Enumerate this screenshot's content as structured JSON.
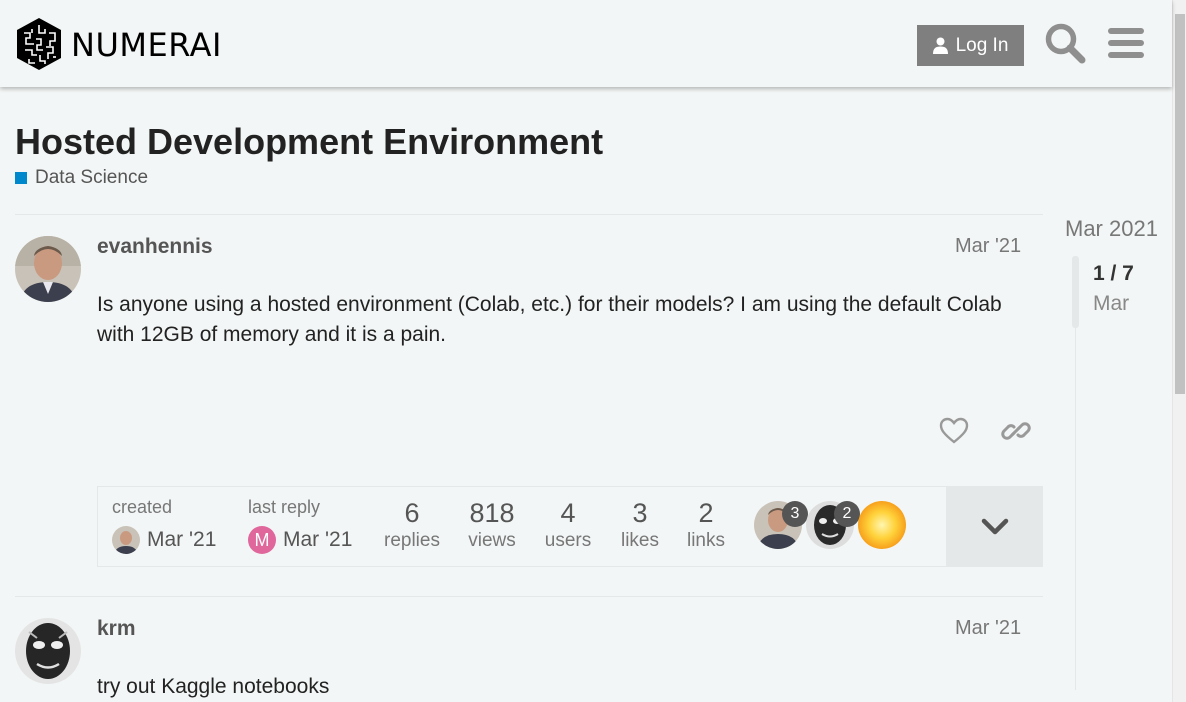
{
  "header": {
    "logo_text": "NUMERAI",
    "login_label": "Log In"
  },
  "topic": {
    "title": "Hosted Development Environment",
    "category": "Data Science",
    "category_color": "#0088cc"
  },
  "posts": [
    {
      "username": "evanhennis",
      "date": "Mar '21",
      "body": "Is anyone using a hosted environment (Colab, etc.) for their models? I am using the default Colab with 12GB of memory and it is a pain."
    },
    {
      "username": "krm",
      "date": "Mar '21",
      "body": "try out Kaggle notebooks"
    }
  ],
  "topic_map": {
    "created_label": "created",
    "created_date": "Mar '21",
    "last_reply_label": "last reply",
    "last_reply_date": "Mar '21",
    "last_reply_avatar_letter": "M",
    "stats": [
      {
        "num": "6",
        "label": "replies"
      },
      {
        "num": "818",
        "label": "views"
      },
      {
        "num": "4",
        "label": "users"
      },
      {
        "num": "3",
        "label": "likes"
      },
      {
        "num": "2",
        "label": "links"
      }
    ],
    "participant_counts": [
      "3",
      "2"
    ]
  },
  "timeline": {
    "top_date": "Mar 2021",
    "position": "1 / 7",
    "current_date": "Mar"
  }
}
